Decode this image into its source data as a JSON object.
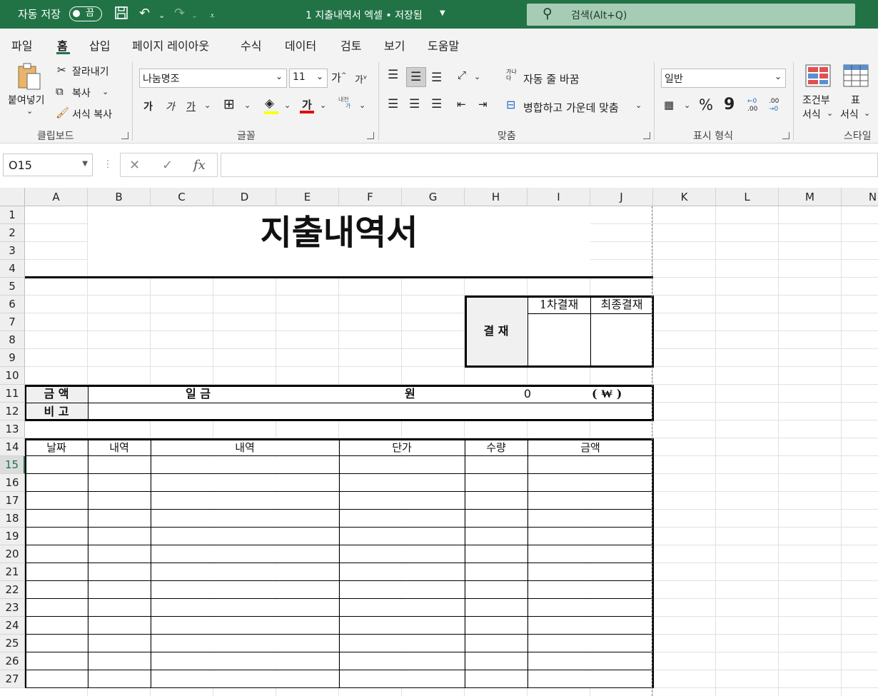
{
  "titlebar": {
    "autosave_label": "자동 저장",
    "autosave_state": "끔",
    "doc_title": "1 지출내역서 엑셀 • 저장됨",
    "search_placeholder": "검색(Alt+Q)"
  },
  "tabs": [
    "파일",
    "홈",
    "삽입",
    "페이지 레이아웃",
    "수식",
    "데이터",
    "검토",
    "보기",
    "도움말"
  ],
  "active_tab": "홈",
  "ribbon": {
    "clipboard": {
      "paste": "붙여넣기",
      "cut": "잘라내기",
      "copy": "복사",
      "format_painter": "서식 복사",
      "group": "클립보드"
    },
    "font": {
      "name": "나눔명조",
      "size": "11",
      "bold": "가",
      "italic": "가",
      "underline": "가",
      "grow": "가",
      "shrink": "가",
      "group": "글꼴",
      "font_color": "가",
      "phonetic_top": "내천",
      "phonetic_bottom": "가"
    },
    "alignment": {
      "wrap": "자동 줄 바꿈",
      "merge": "병합하고 가운데 맞춤",
      "group": "맞춤",
      "wrap_icon_top": "가나",
      "wrap_icon_bottom": "다"
    },
    "number": {
      "format": "일반",
      "group": "표시 형식",
      "percent": "%",
      "comma": "9",
      "inc_top": "←0",
      "inc_bottom": ".00",
      "dec_top": ".00",
      "dec_bottom": "→0"
    },
    "styles": {
      "cond_top": "조건부",
      "cond_bottom": "서식",
      "table_top": "표",
      "table_bottom": "서식",
      "group": "스타일"
    }
  },
  "formula_bar": {
    "name_box": "O15",
    "cancel": "✕",
    "enter": "✓",
    "fx": "fx",
    "value": ""
  },
  "columns": [
    "A",
    "B",
    "C",
    "D",
    "E",
    "F",
    "G",
    "H",
    "I",
    "J",
    "K",
    "L",
    "M",
    "N"
  ],
  "rows": [
    "1",
    "2",
    "3",
    "4",
    "5",
    "6",
    "7",
    "8",
    "9",
    "10",
    "11",
    "12",
    "13",
    "14",
    "15",
    "16",
    "17",
    "18",
    "19",
    "20",
    "21",
    "22",
    "23",
    "24",
    "25",
    "26",
    "27"
  ],
  "selected_row": "15",
  "sheet": {
    "title": "지출내역서",
    "approval_label": "결 재",
    "approval_first": "1차결재",
    "approval_final": "최종결재",
    "amount_label": "금 액",
    "amount_words_label": "일 금",
    "won": "원",
    "amount_value": "0",
    "currency": "( ₩ )",
    "remarks_label": "비 고",
    "table_headers": [
      "날짜",
      "내역",
      "내역",
      "단가",
      "수량",
      "금액"
    ]
  }
}
